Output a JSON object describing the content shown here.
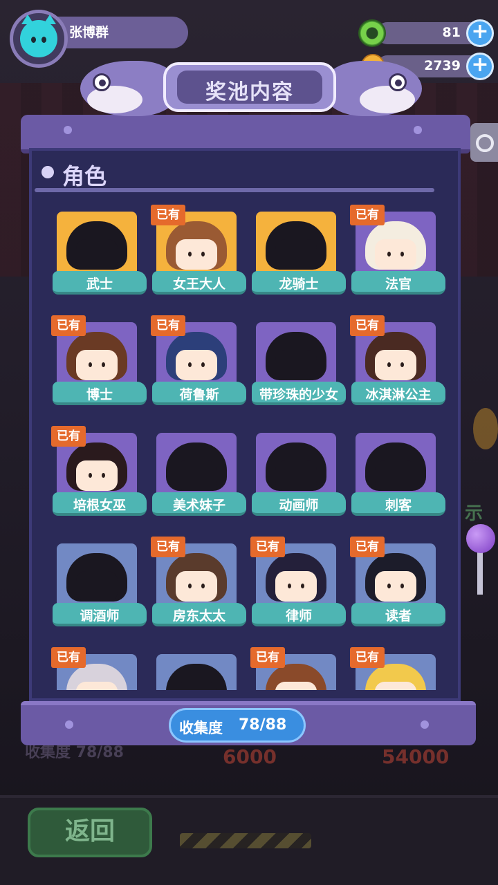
{
  "player": {
    "name": "张博群"
  },
  "currencies": [
    {
      "icon": "green-gem-icon",
      "value": "81"
    },
    {
      "icon": "planet-coin-icon",
      "value": "2739"
    }
  ],
  "banner": {
    "title": "奖池内容"
  },
  "section": {
    "label": "角色"
  },
  "owned_label": "已有",
  "cards": [
    {
      "name": "武士",
      "owned": false,
      "frame": "gold",
      "silhouette": true,
      "hair": "#1a1720"
    },
    {
      "name": "女王大人",
      "owned": true,
      "frame": "gold",
      "silhouette": false,
      "hair": "#9a5a33"
    },
    {
      "name": "龙骑士",
      "owned": false,
      "frame": "gold",
      "silhouette": true,
      "hair": "#1a1720"
    },
    {
      "name": "法官",
      "owned": true,
      "frame": "purple",
      "silhouette": false,
      "hair": "#f4ede0"
    },
    {
      "name": "博士",
      "owned": true,
      "frame": "purple",
      "silhouette": false,
      "hair": "#6a3a24"
    },
    {
      "name": "荷鲁斯",
      "owned": true,
      "frame": "purple",
      "silhouette": false,
      "hair": "#2c3f7a"
    },
    {
      "name": "带珍珠的少女",
      "owned": false,
      "frame": "purple",
      "silhouette": true,
      "hair": "#1a1720"
    },
    {
      "name": "冰淇淋公主",
      "owned": true,
      "frame": "purple",
      "silhouette": false,
      "hair": "#4a2a22"
    },
    {
      "name": "培根女巫",
      "owned": true,
      "frame": "purple",
      "silhouette": false,
      "hair": "#2a1a1d"
    },
    {
      "name": "美术妹子",
      "owned": false,
      "frame": "purple",
      "silhouette": true,
      "hair": "#1a1720"
    },
    {
      "name": "动画师",
      "owned": false,
      "frame": "purple",
      "silhouette": true,
      "hair": "#1a1720"
    },
    {
      "name": "刺客",
      "owned": false,
      "frame": "purple",
      "silhouette": true,
      "hair": "#1a1720"
    },
    {
      "name": "调酒师",
      "owned": false,
      "frame": "blue",
      "silhouette": true,
      "hair": "#1a1720"
    },
    {
      "name": "房东太太",
      "owned": true,
      "frame": "blue",
      "silhouette": false,
      "hair": "#5a3b2c"
    },
    {
      "name": "律师",
      "owned": true,
      "frame": "blue",
      "silhouette": false,
      "hair": "#24203a"
    },
    {
      "name": "读者",
      "owned": true,
      "frame": "blue",
      "silhouette": false,
      "hair": "#1c1c2a"
    },
    {
      "name": "",
      "owned": true,
      "frame": "blue",
      "silhouette": false,
      "hair": "#d8d2dc"
    },
    {
      "name": "",
      "owned": false,
      "frame": "blue",
      "silhouette": true,
      "hair": "#1a1720"
    },
    {
      "name": "",
      "owned": true,
      "frame": "blue",
      "silhouette": false,
      "hair": "#8a4a2a"
    },
    {
      "name": "",
      "owned": true,
      "frame": "blue",
      "silhouette": false,
      "hair": "#f2c94c"
    }
  ],
  "collection": {
    "label": "收集度",
    "value": "78/88"
  },
  "background": {
    "back_button": "返回",
    "ghost_collect": "收集度 78/88",
    "price_1": "6000",
    "price_2": "54000",
    "side_text": "示"
  }
}
